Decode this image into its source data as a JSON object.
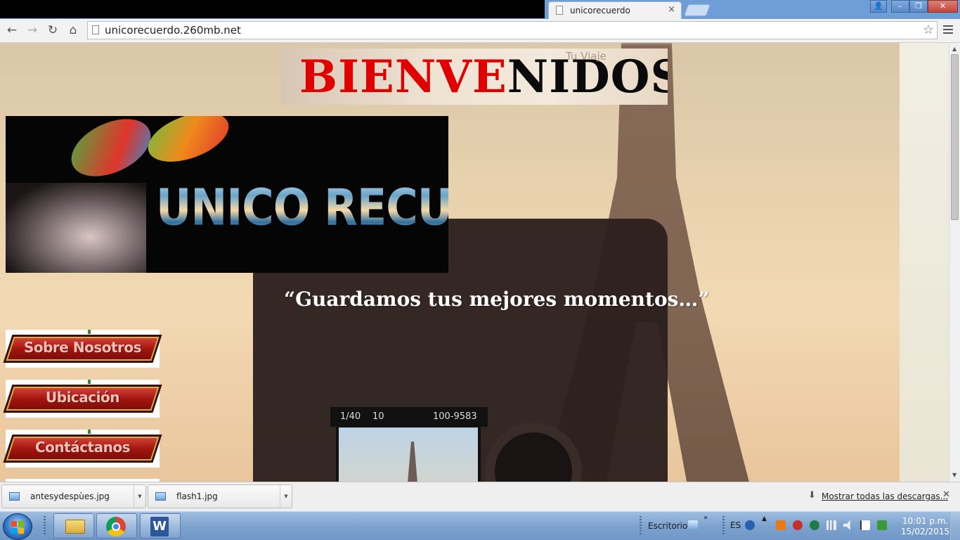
{
  "browser": {
    "tab_title": "unicorecuerdo",
    "tab_close": "×",
    "url": "unicorecuerdo.260mb.net",
    "nav": {
      "back": "←",
      "forward": "→",
      "reload": "↻",
      "home": "⌂"
    },
    "bookmark_icon": "☆",
    "window_controls": {
      "user": "👤",
      "minimize": "–",
      "restore": "❐",
      "close": "✕"
    }
  },
  "page": {
    "welcome_red": "BIENVE",
    "welcome_black": "NIDOS",
    "welcome_deco": "Tu Viaje",
    "logo_text": "UNICO RECUERDO",
    "slogan": "“Guardamos tus mejores momentos…”",
    "camera_readout": {
      "shutter": "1/40",
      "aperture": "10",
      "frame": "100-9583"
    },
    "menu": [
      {
        "label": "Sobre Nosotros"
      },
      {
        "label": "Ubicación"
      },
      {
        "label": "Contáctanos"
      }
    ]
  },
  "downloads": {
    "items": [
      {
        "name": "antesydespùes.jpg"
      },
      {
        "name": "flash1.jpg"
      }
    ],
    "dropdown_icon": "▼",
    "show_all": "Mostrar todas las descargas...",
    "show_all_icon": "⬇",
    "close": "✕"
  },
  "taskbar": {
    "desktop_label": "Escritorio",
    "language": "ES",
    "word_letter": "W",
    "time": "10:01 p.m.",
    "date": "15/02/2015"
  },
  "colors": {
    "welcome_red": "#e10000",
    "taskbar": "#7ea3cf"
  }
}
